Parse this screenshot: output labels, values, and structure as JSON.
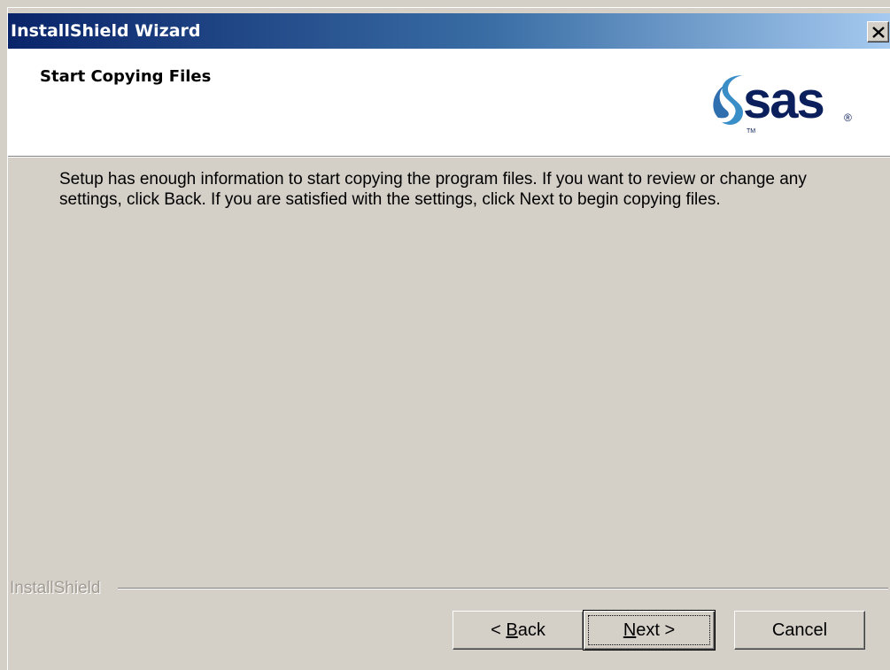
{
  "window": {
    "title": "InstallShield Wizard",
    "close_icon": "close-icon"
  },
  "header": {
    "title": "Start Copying Files",
    "logo": {
      "text": "sas",
      "trademark": "TM",
      "registered": "®",
      "icon": "sas-swirl-icon",
      "colors": {
        "swirl": "#3a8ec8",
        "text": "#0b1f5c"
      }
    }
  },
  "body": {
    "message": "Setup has enough information to start copying the program files.  If you want to review or change any settings, click Back.  If you are satisfied with the settings, click Next to begin copying files."
  },
  "footer": {
    "brand": "InstallShield",
    "buttons": {
      "back": {
        "prefix": "< ",
        "mnemonic": "B",
        "rest": "ack"
      },
      "next": {
        "mnemonic": "N",
        "rest": "ext >"
      },
      "cancel": "Cancel"
    }
  },
  "colors": {
    "title_gradient_start": "#0a246a",
    "title_gradient_end": "#a6caf0",
    "dialog_face": "#d4d0c8"
  }
}
